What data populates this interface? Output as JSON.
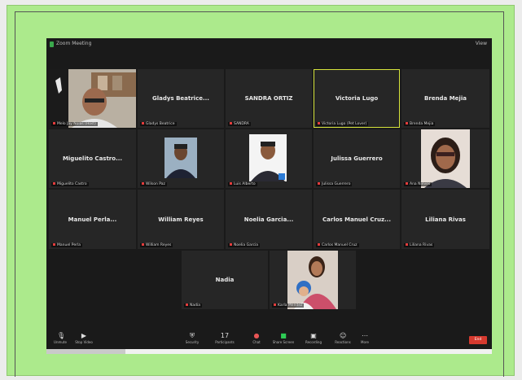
{
  "window": {
    "title": "Zoom Meeting",
    "view_label": "View"
  },
  "tiles": [
    {
      "name": "",
      "label": "Melo Jay Nolas (Host)",
      "photo": "man-glasses-webcam"
    },
    {
      "name": "Gladys Beatrice...",
      "label": "Gladys Beatrice"
    },
    {
      "name": "SANDRA ORTIZ",
      "label": "SANDRA"
    },
    {
      "name": "Victoria Lugo",
      "label": "Victoria Lugo (Pet Lover)"
    },
    {
      "name": "Brenda Mejia",
      "label": "Brenda Mejia"
    },
    {
      "name": "Miguelito Castro...",
      "label": "Miguelito Castro"
    },
    {
      "name": "",
      "label": "Wilson Paz",
      "photo": "man-portrait"
    },
    {
      "name": "",
      "label": "Luis Alberto",
      "photo": "man-id-photo"
    },
    {
      "name": "Julissa Guerrero",
      "label": "Julissa Guerrero"
    },
    {
      "name": "",
      "label": "Ana Nieves",
      "photo": "woman-glasses"
    },
    {
      "name": "Manuel Perla...",
      "label": "Manuel Perla"
    },
    {
      "name": "William Reyes",
      "label": "William Reyes"
    },
    {
      "name": "Noelia Garcia...",
      "label": "Noelia Garcia"
    },
    {
      "name": "Carlos Manuel Cruz...",
      "label": "Carlos Manuel Cruz"
    },
    {
      "name": "Liliana Rivas",
      "label": "Liliana Rivas"
    },
    {
      "name": "Nadia",
      "label": "Nadia"
    },
    {
      "name": "",
      "label": "Karla Mendez",
      "photo": "woman-with-baby"
    }
  ],
  "controls": {
    "unmute": "Unmute",
    "stop_video": "Stop Video",
    "security": "Security",
    "participants": "Participants",
    "participant_count": "17",
    "chat": "Chat",
    "share_screen": "Share Screen",
    "record": "Recording",
    "reactions": "Reactions",
    "more": "More",
    "end": "End"
  },
  "colors": {
    "frame_green": "#acea8c",
    "active_speaker": "#d6e43c",
    "end_red": "#d63a2f",
    "tile_bg": "#262626"
  }
}
